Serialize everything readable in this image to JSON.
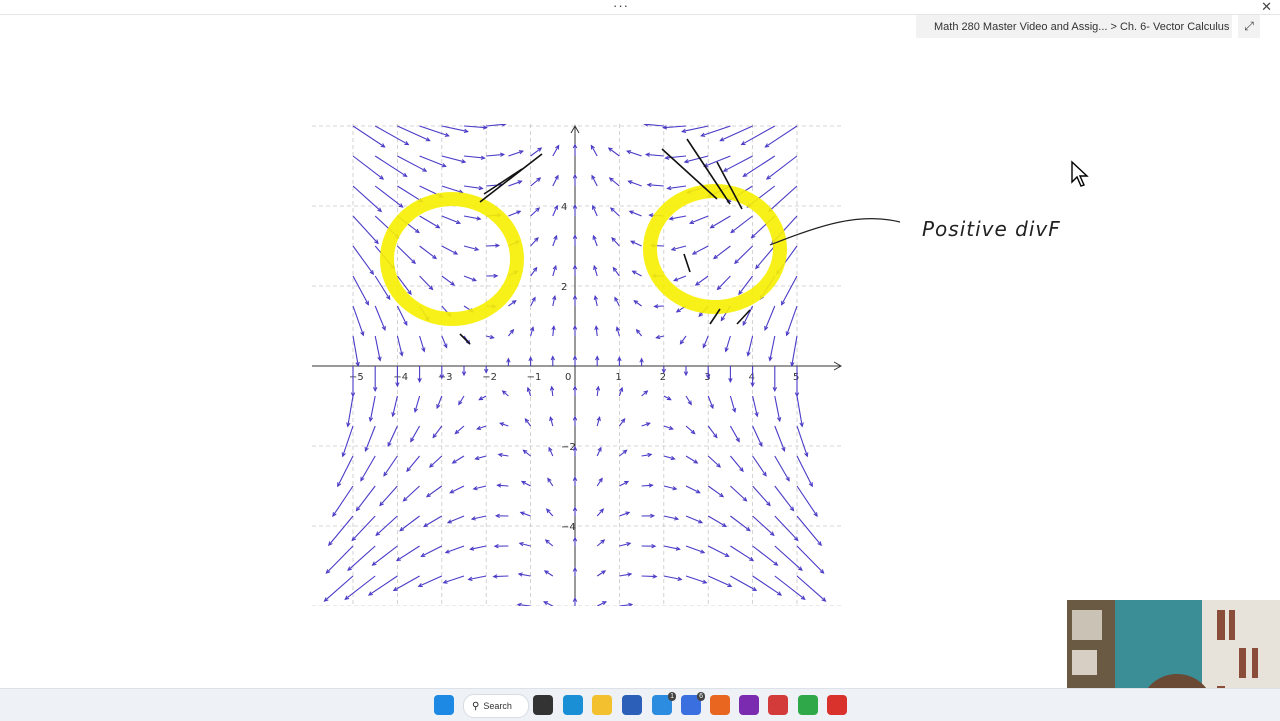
{
  "window": {
    "menu_dots": "···",
    "close_label": "✕"
  },
  "notebook": {
    "path": "Math 280 Master Video and Assig...  >  Ch. 6- Vector Calculus",
    "expand_label": "⤢"
  },
  "plot": {
    "x_ticks": [
      "−5",
      "−4",
      "−3",
      "−2",
      "−1",
      "0",
      "1",
      "2",
      "3",
      "4",
      "5"
    ],
    "y_ticks": [
      "4",
      "2",
      "−2",
      "−4"
    ],
    "arrow_color": "#4a3bc7",
    "grid_color": "#c8c8c8",
    "x_range": [
      -6,
      6
    ],
    "y_range": [
      -6,
      6
    ]
  },
  "annotation": {
    "text": "Positive divF",
    "highlight_color": "#f7f000"
  },
  "taskbar": {
    "search_label": "Search",
    "items": [
      {
        "name": "start",
        "color": "#1e88e5"
      },
      {
        "name": "task-view",
        "color": "#333333"
      },
      {
        "name": "edge",
        "color": "#1a8fd6"
      },
      {
        "name": "file-explorer",
        "color": "#f3c130"
      },
      {
        "name": "store",
        "color": "#2b5fb8"
      },
      {
        "name": "mail",
        "color": "#2b8ce0",
        "badge": "1"
      },
      {
        "name": "todo",
        "color": "#3a6fe0",
        "badge": "6"
      },
      {
        "name": "firefox",
        "color": "#e8661f"
      },
      {
        "name": "onenote",
        "color": "#7b2bb0"
      },
      {
        "name": "snipping-tool",
        "color": "#d33b3b"
      },
      {
        "name": "camtasia",
        "color": "#2fa84a"
      },
      {
        "name": "recorder",
        "color": "#d9312b"
      }
    ]
  }
}
